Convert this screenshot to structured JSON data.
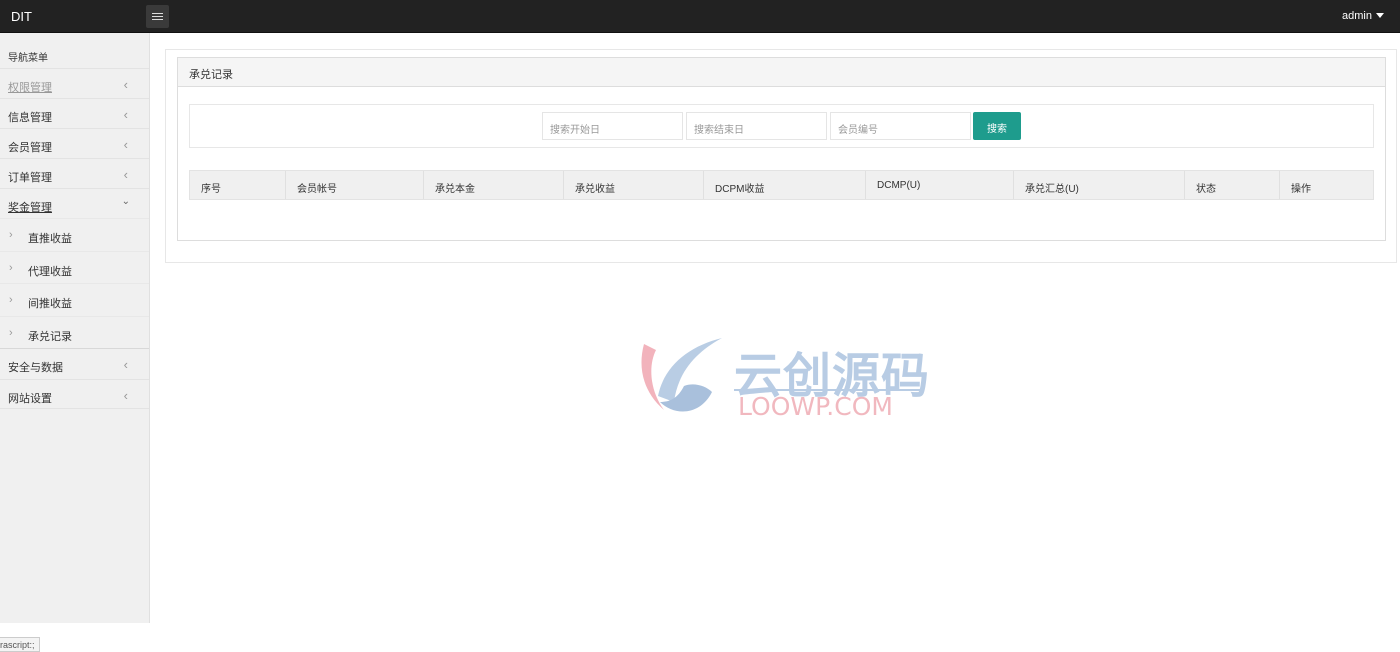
{
  "header": {
    "brand": "DIT",
    "user": "admin",
    "menu_toggle_icon": "hamburger-icon"
  },
  "sidebar": {
    "title": "导航菜单",
    "items": [
      {
        "label": "权限管理",
        "icon": "chevron-left-icon"
      },
      {
        "label": "信息管理",
        "icon": "chevron-left-icon"
      },
      {
        "label": "会员管理",
        "icon": "chevron-left-icon"
      },
      {
        "label": "订单管理",
        "icon": "chevron-left-icon"
      },
      {
        "label": "奖金管理",
        "icon": "chevron-down-icon"
      },
      {
        "label": "安全与数据",
        "icon": "chevron-left-icon"
      },
      {
        "label": "网站设置",
        "icon": "chevron-left-icon"
      }
    ],
    "subitems": [
      {
        "label": "直推收益"
      },
      {
        "label": "代理收益"
      },
      {
        "label": "间推收益"
      },
      {
        "label": "承兑记录"
      }
    ]
  },
  "panel": {
    "title": "承兑记录"
  },
  "search": {
    "start_placeholder": "搜索开始日",
    "end_placeholder": "搜索结束日",
    "member_placeholder": "会员编号",
    "button": "搜索"
  },
  "table": {
    "columns": [
      "序号",
      "会员帐号",
      "承兑本金",
      "承兑收益",
      "DCPM收益",
      "DCMP(U)",
      "承兑汇总(U)",
      "状态",
      "操作"
    ],
    "rows": []
  },
  "watermark": {
    "cn": "云创源码",
    "en": "LOOWP.COM"
  },
  "statusbar": {
    "text": "rascript:;"
  },
  "colors": {
    "topbar": "#222222",
    "accent": "#1e9c8d"
  }
}
